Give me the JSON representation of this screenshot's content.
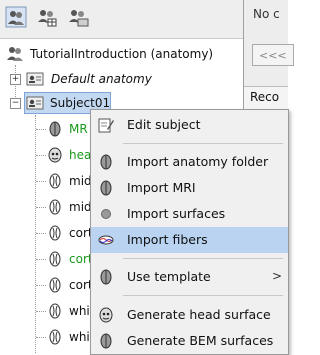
{
  "right_panel": {
    "no_label": "No c",
    "nav_button": "<<<",
    "rec_label": "Reco"
  },
  "tree": {
    "root": "TutorialIntroduction (anatomy)",
    "default_anatomy": "Default anatomy",
    "subject": "Subject01",
    "children": [
      {
        "label": "MR",
        "color": "#1a9a1a"
      },
      {
        "label": "hea",
        "color": "#1a9a1a"
      },
      {
        "label": "mid",
        "color": "#111111"
      },
      {
        "label": "mid",
        "color": "#111111"
      },
      {
        "label": "cort",
        "color": "#111111"
      },
      {
        "label": "cort",
        "color": "#1a9a1a"
      },
      {
        "label": "cort",
        "color": "#111111"
      },
      {
        "label": "whit",
        "color": "#111111"
      },
      {
        "label": "whit",
        "color": "#111111"
      }
    ]
  },
  "menu": {
    "edit_subject": "Edit subject",
    "import_anatomy_folder": "Import anatomy folder",
    "import_mri": "Import MRI",
    "import_surfaces": "Import surfaces",
    "import_fibers": "Import fibers",
    "use_template": "Use template",
    "generate_head_surface": "Generate head surface",
    "generate_bem_surfaces": "Generate BEM surfaces",
    "submenu_arrow": ">"
  },
  "colors": {
    "highlight": "#b9d3f0",
    "green_label": "#1a9a1a"
  }
}
